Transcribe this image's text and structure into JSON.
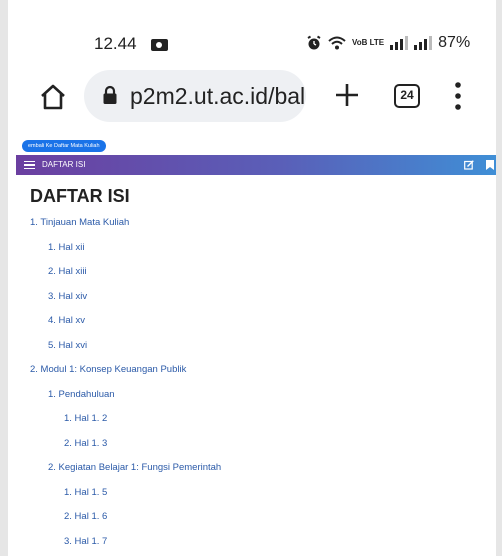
{
  "status_bar": {
    "time": "12.44",
    "battery": "87%",
    "network_label": "VoB LTE",
    "icons": [
      "screen-record-icon",
      "alarm-icon",
      "wifi-icon",
      "signal-icon",
      "signal-icon"
    ]
  },
  "browser": {
    "url": "p2m2.ut.ac.id/bal",
    "tab_count": "24",
    "icons": [
      "home-icon",
      "lock-icon",
      "new-tab-plus-icon",
      "tabs-counter",
      "menu-icon"
    ]
  },
  "page": {
    "back_link": "embali Ke Daftar Mata Kuliah",
    "toolbar_title": "DAFTAR ISI",
    "heading": "DAFTAR ISI",
    "toc": [
      {
        "label": "1. Tinjauan Mata Kuliah",
        "level": 0
      },
      {
        "label": "1. Hal xii",
        "level": 1
      },
      {
        "label": "2. Hal xiii",
        "level": 1
      },
      {
        "label": "3. Hal xiv",
        "level": 1
      },
      {
        "label": "4. Hal xv",
        "level": 1
      },
      {
        "label": "5. Hal xvi",
        "level": 1
      },
      {
        "label": "2. Modul 1: Konsep Keuangan Publik",
        "level": 0
      },
      {
        "label": "1. Pendahuluan",
        "level": 1
      },
      {
        "label": "1. Hal 1. 2",
        "level": 2
      },
      {
        "label": "2. Hal 1. 3",
        "level": 2
      },
      {
        "label": "2. Kegiatan Belajar 1: Fungsi Pemerintah",
        "level": 1
      },
      {
        "label": "1. Hal 1. 5",
        "level": 2
      },
      {
        "label": "2. Hal 1. 6",
        "level": 2
      },
      {
        "label": "3. Hal 1. 7",
        "level": 2
      }
    ]
  },
  "colors": {
    "link": "#2b5aa8",
    "chip": "#1a73e8",
    "toolbar_start": "#6b3fa0",
    "toolbar_end": "#3f8fd6"
  }
}
